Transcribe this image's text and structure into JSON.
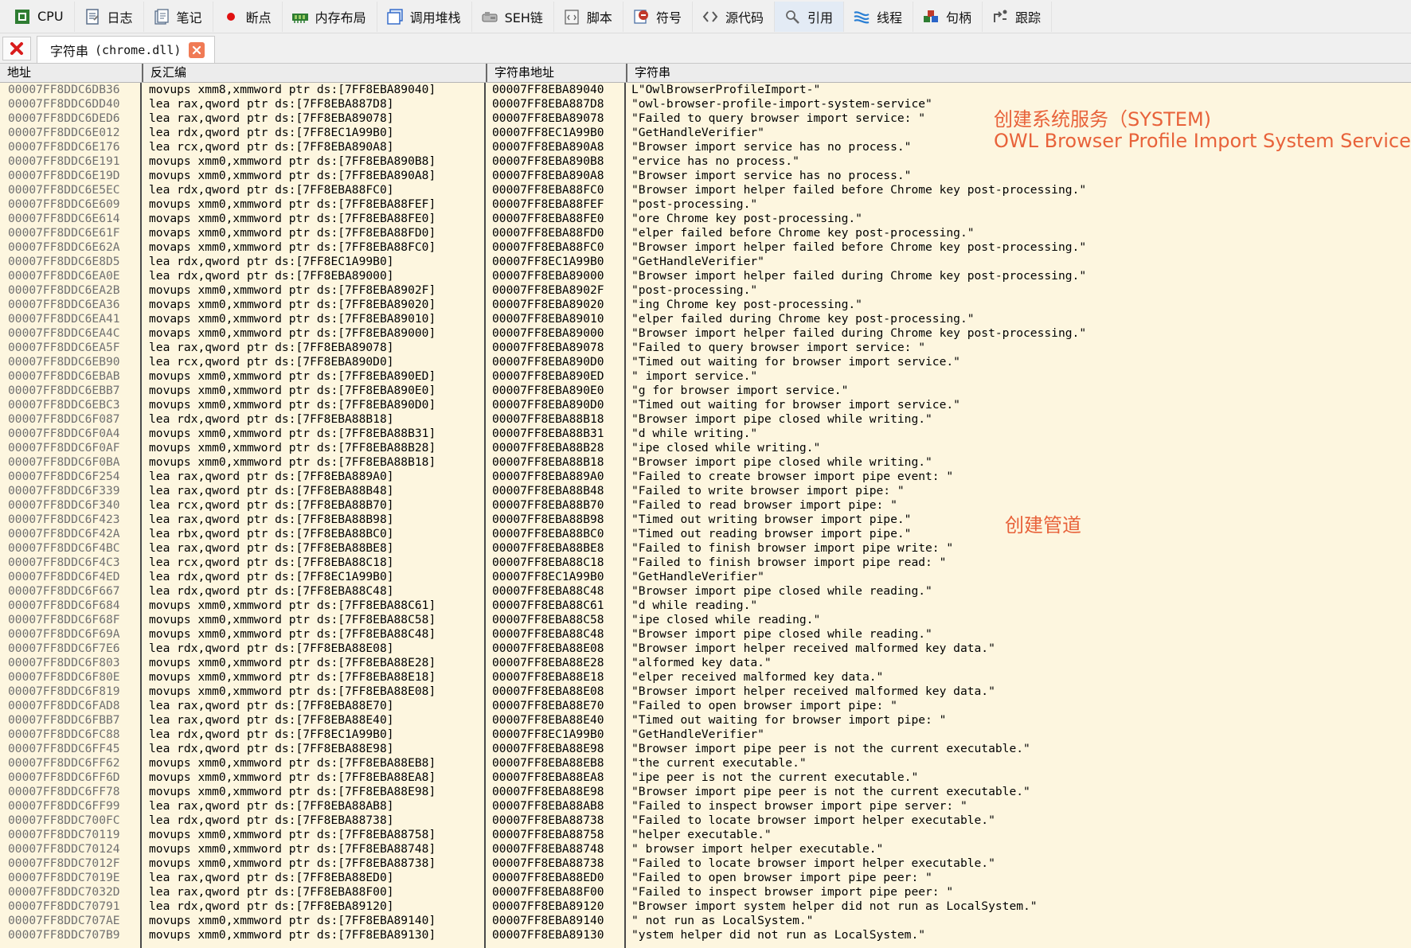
{
  "toolbar": {
    "items": [
      {
        "label": "CPU",
        "icon": "cpu-icon",
        "color": "#2e7d32"
      },
      {
        "label": "日志",
        "icon": "log-icon",
        "color": "#5b6f8a"
      },
      {
        "label": "笔记",
        "icon": "notes-icon",
        "color": "#5b6f8a"
      },
      {
        "label": "断点",
        "icon": "breakpoint-icon",
        "color": "#e01010"
      },
      {
        "label": "内存布局",
        "icon": "memory-map-icon",
        "color": "#2e7d32"
      },
      {
        "label": "调用堆栈",
        "icon": "call-stack-icon",
        "color": "#2a64c8"
      },
      {
        "label": "SEH链",
        "icon": "seh-chain-icon",
        "color": "#666666"
      },
      {
        "label": "脚本",
        "icon": "script-icon",
        "color": "#666666"
      },
      {
        "label": "符号",
        "icon": "symbols-icon",
        "color": "#c0392b"
      },
      {
        "label": "源代码",
        "icon": "source-icon",
        "color": "#555555"
      },
      {
        "label": "引用",
        "icon": "references-icon",
        "color": "#666666"
      },
      {
        "label": "线程",
        "icon": "threads-icon",
        "color": "#2a7fd4"
      },
      {
        "label": "句柄",
        "icon": "handles-icon",
        "color": "#c0392b"
      },
      {
        "label": "跟踪",
        "icon": "trace-icon",
        "color": "#555555"
      }
    ],
    "active_index": 10
  },
  "tabs": {
    "active_label": "字符串",
    "active_module": "(chrome.dll)"
  },
  "columns": {
    "address": "地址",
    "disassembly": "反汇编",
    "string_address": "字符串地址",
    "string": "字符串"
  },
  "annotations": {
    "service_cn": "创建系统服务（SYSTEM)",
    "service_en": "OWL Browser Profile Import System Service",
    "pipe_cn": "创建管道"
  },
  "colors": {
    "annotation": "#e8623a",
    "grid_background": "#fdf6df",
    "address_text": "#707070"
  },
  "rows": [
    {
      "addr": "00007FF8DDC6DB36",
      "asm": "movups xmm8,xmmword ptr ds:[7FF8EBA89040]",
      "saddr": "00007FF8EBA89040",
      "str": "L\"OwlBrowserProfileImport-\""
    },
    {
      "addr": "00007FF8DDC6DD40",
      "asm": "lea rax,qword ptr ds:[7FF8EBA887D8]",
      "saddr": "00007FF8EBA887D8",
      "str": "\"owl-browser-profile-import-system-service\""
    },
    {
      "addr": "00007FF8DDC6DED6",
      "asm": "lea rax,qword ptr ds:[7FF8EBA89078]",
      "saddr": "00007FF8EBA89078",
      "str": "\"Failed to query browser import service: \""
    },
    {
      "addr": "00007FF8DDC6E012",
      "asm": "lea rdx,qword ptr ds:[7FF8EC1A99B0]",
      "saddr": "00007FF8EC1A99B0",
      "str": "\"GetHandleVerifier\""
    },
    {
      "addr": "00007FF8DDC6E176",
      "asm": "lea rcx,qword ptr ds:[7FF8EBA890A8]",
      "saddr": "00007FF8EBA890A8",
      "str": "\"Browser import service has no process.\""
    },
    {
      "addr": "00007FF8DDC6E191",
      "asm": "movups xmm0,xmmword ptr ds:[7FF8EBA890B8]",
      "saddr": "00007FF8EBA890B8",
      "str": "\"ervice has no process.\""
    },
    {
      "addr": "00007FF8DDC6E19D",
      "asm": "movups xmm0,xmmword ptr ds:[7FF8EBA890A8]",
      "saddr": "00007FF8EBA890A8",
      "str": "\"Browser import service has no process.\""
    },
    {
      "addr": "00007FF8DDC6E5EC",
      "asm": "lea rdx,qword ptr ds:[7FF8EBA88FC0]",
      "saddr": "00007FF8EBA88FC0",
      "str": "\"Browser import helper failed before Chrome key post-processing.\""
    },
    {
      "addr": "00007FF8DDC6E609",
      "asm": "movups xmm0,xmmword ptr ds:[7FF8EBA88FEF]",
      "saddr": "00007FF8EBA88FEF",
      "str": "\"post-processing.\""
    },
    {
      "addr": "00007FF8DDC6E614",
      "asm": "movaps xmm0,xmmword ptr ds:[7FF8EBA88FE0]",
      "saddr": "00007FF8EBA88FE0",
      "str": "\"ore Chrome key post-processing.\""
    },
    {
      "addr": "00007FF8DDC6E61F",
      "asm": "movaps xmm0,xmmword ptr ds:[7FF8EBA88FD0]",
      "saddr": "00007FF8EBA88FD0",
      "str": "\"elper failed before Chrome key post-processing.\""
    },
    {
      "addr": "00007FF8DDC6E62A",
      "asm": "movaps xmm0,xmmword ptr ds:[7FF8EBA88FC0]",
      "saddr": "00007FF8EBA88FC0",
      "str": "\"Browser import helper failed before Chrome key post-processing.\""
    },
    {
      "addr": "00007FF8DDC6E8D5",
      "asm": "lea rdx,qword ptr ds:[7FF8EC1A99B0]",
      "saddr": "00007FF8EC1A99B0",
      "str": "\"GetHandleVerifier\""
    },
    {
      "addr": "00007FF8DDC6EA0E",
      "asm": "lea rdx,qword ptr ds:[7FF8EBA89000]",
      "saddr": "00007FF8EBA89000",
      "str": "\"Browser import helper failed during Chrome key post-processing.\""
    },
    {
      "addr": "00007FF8DDC6EA2B",
      "asm": "movups xmm0,xmmword ptr ds:[7FF8EBA8902F]",
      "saddr": "00007FF8EBA8902F",
      "str": "\"post-processing.\""
    },
    {
      "addr": "00007FF8DDC6EA36",
      "asm": "movaps xmm0,xmmword ptr ds:[7FF8EBA89020]",
      "saddr": "00007FF8EBA89020",
      "str": "\"ing Chrome key post-processing.\""
    },
    {
      "addr": "00007FF8DDC6EA41",
      "asm": "movaps xmm0,xmmword ptr ds:[7FF8EBA89010]",
      "saddr": "00007FF8EBA89010",
      "str": "\"elper failed during Chrome key post-processing.\""
    },
    {
      "addr": "00007FF8DDC6EA4C",
      "asm": "movaps xmm0,xmmword ptr ds:[7FF8EBA89000]",
      "saddr": "00007FF8EBA89000",
      "str": "\"Browser import helper failed during Chrome key post-processing.\""
    },
    {
      "addr": "00007FF8DDC6EA5F",
      "asm": "lea rax,qword ptr ds:[7FF8EBA89078]",
      "saddr": "00007FF8EBA89078",
      "str": "\"Failed to query browser import service: \""
    },
    {
      "addr": "00007FF8DDC6EB90",
      "asm": "lea rcx,qword ptr ds:[7FF8EBA890D0]",
      "saddr": "00007FF8EBA890D0",
      "str": "\"Timed out waiting for browser import service.\""
    },
    {
      "addr": "00007FF8DDC6EBAB",
      "asm": "movups xmm0,xmmword ptr ds:[7FF8EBA890ED]",
      "saddr": "00007FF8EBA890ED",
      "str": "\" import service.\""
    },
    {
      "addr": "00007FF8DDC6EBB7",
      "asm": "movups xmm0,xmmword ptr ds:[7FF8EBA890E0]",
      "saddr": "00007FF8EBA890E0",
      "str": "\"g for browser import service.\""
    },
    {
      "addr": "00007FF8DDC6EBC3",
      "asm": "movups xmm0,xmmword ptr ds:[7FF8EBA890D0]",
      "saddr": "00007FF8EBA890D0",
      "str": "\"Timed out waiting for browser import service.\""
    },
    {
      "addr": "00007FF8DDC6F087",
      "asm": "lea rdx,qword ptr ds:[7FF8EBA88B18]",
      "saddr": "00007FF8EBA88B18",
      "str": "\"Browser import pipe closed while writing.\""
    },
    {
      "addr": "00007FF8DDC6F0A4",
      "asm": "movups xmm0,xmmword ptr ds:[7FF8EBA88B31]",
      "saddr": "00007FF8EBA88B31",
      "str": "\"d while writing.\""
    },
    {
      "addr": "00007FF8DDC6F0AF",
      "asm": "movups xmm0,xmmword ptr ds:[7FF8EBA88B28]",
      "saddr": "00007FF8EBA88B28",
      "str": "\"ipe closed while writing.\""
    },
    {
      "addr": "00007FF8DDC6F0BA",
      "asm": "movups xmm0,xmmword ptr ds:[7FF8EBA88B18]",
      "saddr": "00007FF8EBA88B18",
      "str": "\"Browser import pipe closed while writing.\""
    },
    {
      "addr": "00007FF8DDC6F254",
      "asm": "lea rax,qword ptr ds:[7FF8EBA889A0]",
      "saddr": "00007FF8EBA889A0",
      "str": "\"Failed to create browser import pipe event: \""
    },
    {
      "addr": "00007FF8DDC6F339",
      "asm": "lea rax,qword ptr ds:[7FF8EBA88B48]",
      "saddr": "00007FF8EBA88B48",
      "str": "\"Failed to write browser import pipe: \""
    },
    {
      "addr": "00007FF8DDC6F340",
      "asm": "lea rcx,qword ptr ds:[7FF8EBA88B70]",
      "saddr": "00007FF8EBA88B70",
      "str": "\"Failed to read browser import pipe: \""
    },
    {
      "addr": "00007FF8DDC6F423",
      "asm": "lea rax,qword ptr ds:[7FF8EBA88B98]",
      "saddr": "00007FF8EBA88B98",
      "str": "\"Timed out writing browser import pipe.\""
    },
    {
      "addr": "00007FF8DDC6F42A",
      "asm": "lea rbx,qword ptr ds:[7FF8EBA88BC0]",
      "saddr": "00007FF8EBA88BC0",
      "str": "\"Timed out reading browser import pipe.\""
    },
    {
      "addr": "00007FF8DDC6F4BC",
      "asm": "lea rax,qword ptr ds:[7FF8EBA88BE8]",
      "saddr": "00007FF8EBA88BE8",
      "str": "\"Failed to finish browser import pipe write: \""
    },
    {
      "addr": "00007FF8DDC6F4C3",
      "asm": "lea rcx,qword ptr ds:[7FF8EBA88C18]",
      "saddr": "00007FF8EBA88C18",
      "str": "\"Failed to finish browser import pipe read: \""
    },
    {
      "addr": "00007FF8DDC6F4ED",
      "asm": "lea rdx,qword ptr ds:[7FF8EC1A99B0]",
      "saddr": "00007FF8EC1A99B0",
      "str": "\"GetHandleVerifier\""
    },
    {
      "addr": "00007FF8DDC6F667",
      "asm": "lea rdx,qword ptr ds:[7FF8EBA88C48]",
      "saddr": "00007FF8EBA88C48",
      "str": "\"Browser import pipe closed while reading.\""
    },
    {
      "addr": "00007FF8DDC6F684",
      "asm": "movups xmm0,xmmword ptr ds:[7FF8EBA88C61]",
      "saddr": "00007FF8EBA88C61",
      "str": "\"d while reading.\""
    },
    {
      "addr": "00007FF8DDC6F68F",
      "asm": "movups xmm0,xmmword ptr ds:[7FF8EBA88C58]",
      "saddr": "00007FF8EBA88C58",
      "str": "\"ipe closed while reading.\""
    },
    {
      "addr": "00007FF8DDC6F69A",
      "asm": "movups xmm0,xmmword ptr ds:[7FF8EBA88C48]",
      "saddr": "00007FF8EBA88C48",
      "str": "\"Browser import pipe closed while reading.\""
    },
    {
      "addr": "00007FF8DDC6F7E6",
      "asm": "lea rdx,qword ptr ds:[7FF8EBA88E08]",
      "saddr": "00007FF8EBA88E08",
      "str": "\"Browser import helper received malformed key data.\""
    },
    {
      "addr": "00007FF8DDC6F803",
      "asm": "movups xmm0,xmmword ptr ds:[7FF8EBA88E28]",
      "saddr": "00007FF8EBA88E28",
      "str": "\"alformed key data.\""
    },
    {
      "addr": "00007FF8DDC6F80E",
      "asm": "movups xmm0,xmmword ptr ds:[7FF8EBA88E18]",
      "saddr": "00007FF8EBA88E18",
      "str": "\"elper received malformed key data.\""
    },
    {
      "addr": "00007FF8DDC6F819",
      "asm": "movups xmm0,xmmword ptr ds:[7FF8EBA88E08]",
      "saddr": "00007FF8EBA88E08",
      "str": "\"Browser import helper received malformed key data.\""
    },
    {
      "addr": "00007FF8DDC6FAD8",
      "asm": "lea rax,qword ptr ds:[7FF8EBA88E70]",
      "saddr": "00007FF8EBA88E70",
      "str": "\"Failed to open browser import pipe: \""
    },
    {
      "addr": "00007FF8DDC6FBB7",
      "asm": "lea rax,qword ptr ds:[7FF8EBA88E40]",
      "saddr": "00007FF8EBA88E40",
      "str": "\"Timed out waiting for browser import pipe: \""
    },
    {
      "addr": "00007FF8DDC6FC88",
      "asm": "lea rdx,qword ptr ds:[7FF8EC1A99B0]",
      "saddr": "00007FF8EC1A99B0",
      "str": "\"GetHandleVerifier\""
    },
    {
      "addr": "00007FF8DDC6FF45",
      "asm": "lea rdx,qword ptr ds:[7FF8EBA88E98]",
      "saddr": "00007FF8EBA88E98",
      "str": "\"Browser import pipe peer is not the current executable.\""
    },
    {
      "addr": "00007FF8DDC6FF62",
      "asm": "movups xmm0,xmmword ptr ds:[7FF8EBA88EB8]",
      "saddr": "00007FF8EBA88EB8",
      "str": "\"the current executable.\""
    },
    {
      "addr": "00007FF8DDC6FF6D",
      "asm": "movups xmm0,xmmword ptr ds:[7FF8EBA88EA8]",
      "saddr": "00007FF8EBA88EA8",
      "str": "\"ipe peer is not the current executable.\""
    },
    {
      "addr": "00007FF8DDC6FF78",
      "asm": "movups xmm0,xmmword ptr ds:[7FF8EBA88E98]",
      "saddr": "00007FF8EBA88E98",
      "str": "\"Browser import pipe peer is not the current executable.\""
    },
    {
      "addr": "00007FF8DDC6FF99",
      "asm": "lea rax,qword ptr ds:[7FF8EBA88AB8]",
      "saddr": "00007FF8EBA88AB8",
      "str": "\"Failed to inspect browser import pipe server: \""
    },
    {
      "addr": "00007FF8DDC700FC",
      "asm": "lea rdx,qword ptr ds:[7FF8EBA88738]",
      "saddr": "00007FF8EBA88738",
      "str": "\"Failed to locate browser import helper executable.\""
    },
    {
      "addr": "00007FF8DDC70119",
      "asm": "movups xmm0,xmmword ptr ds:[7FF8EBA88758]",
      "saddr": "00007FF8EBA88758",
      "str": "\"helper executable.\""
    },
    {
      "addr": "00007FF8DDC70124",
      "asm": "movups xmm0,xmmword ptr ds:[7FF8EBA88748]",
      "saddr": "00007FF8EBA88748",
      "str": "\" browser import helper executable.\""
    },
    {
      "addr": "00007FF8DDC7012F",
      "asm": "movups xmm0,xmmword ptr ds:[7FF8EBA88738]",
      "saddr": "00007FF8EBA88738",
      "str": "\"Failed to locate browser import helper executable.\""
    },
    {
      "addr": "00007FF8DDC7019E",
      "asm": "lea rax,qword ptr ds:[7FF8EBA88ED0]",
      "saddr": "00007FF8EBA88ED0",
      "str": "\"Failed to open browser import pipe peer: \""
    },
    {
      "addr": "00007FF8DDC7032D",
      "asm": "lea rax,qword ptr ds:[7FF8EBA88F00]",
      "saddr": "00007FF8EBA88F00",
      "str": "\"Failed to inspect browser import pipe peer: \""
    },
    {
      "addr": "00007FF8DDC70791",
      "asm": "lea rdx,qword ptr ds:[7FF8EBA89120]",
      "saddr": "00007FF8EBA89120",
      "str": "\"Browser import system helper did not run as LocalSystem.\""
    },
    {
      "addr": "00007FF8DDC707AE",
      "asm": "movups xmm0,xmmword ptr ds:[7FF8EBA89140]",
      "saddr": "00007FF8EBA89140",
      "str": "\" not run as LocalSystem.\""
    },
    {
      "addr": "00007FF8DDC707B9",
      "asm": "movups xmm0,xmmword ptr ds:[7FF8EBA89130]",
      "saddr": "00007FF8EBA89130",
      "str": "\"ystem helper did not run as LocalSystem.\""
    }
  ]
}
